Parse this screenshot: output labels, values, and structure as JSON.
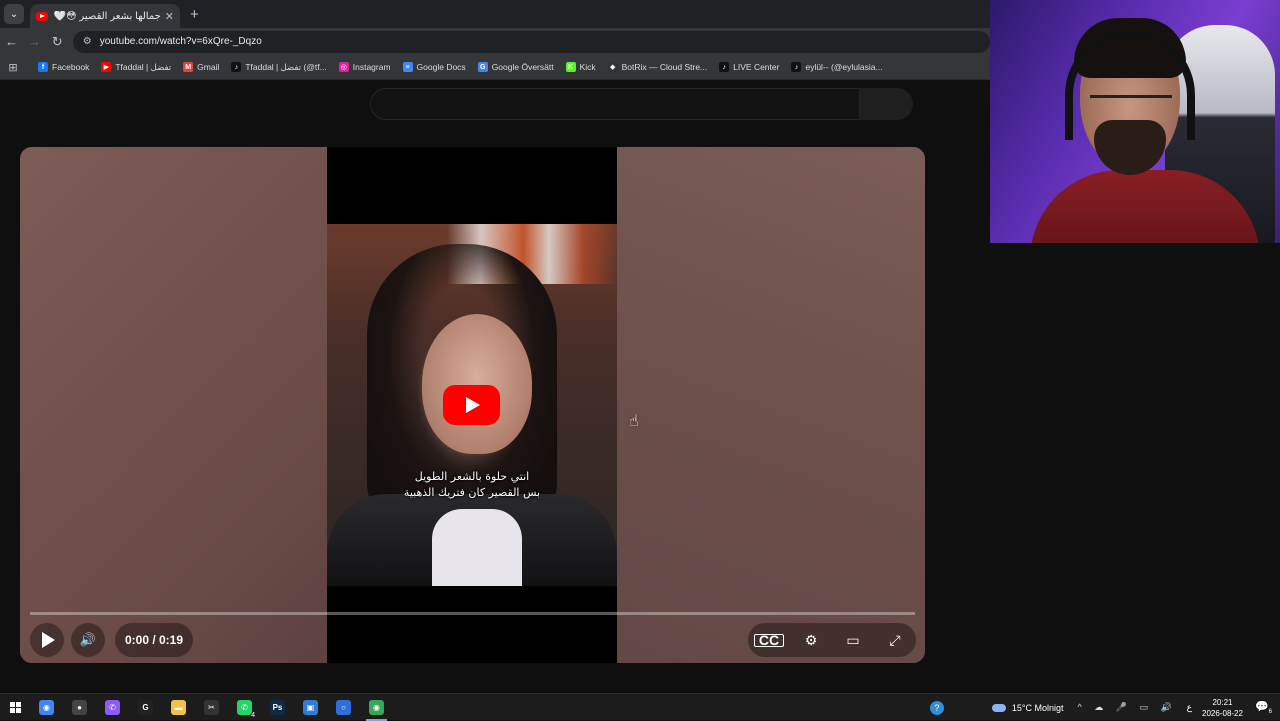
{
  "browser": {
    "tab_title": "جمالها بشعر القصير 😳🤍 #مسلسل",
    "tab_close": "✕",
    "new_tab": "+",
    "tab_dropdown": "⌄",
    "url": "youtube.com/watch?v=6xQre-_Dqzo",
    "nav": {
      "back": "←",
      "forward": "→",
      "reload": "↻",
      "site_info": "⚙"
    }
  },
  "bookmarks": [
    {
      "label": "Facebook",
      "icon": "facebook-icon",
      "color": "#1877f2",
      "glyph": "f"
    },
    {
      "label": "Tfaddal | تفضل",
      "icon": "youtube-icon",
      "color": "#ff0000",
      "glyph": "▶"
    },
    {
      "label": "Gmail",
      "icon": "gmail-icon",
      "color": "#ea4335",
      "glyph": "M"
    },
    {
      "label": "Tfaddal | تفضل (@tf...",
      "icon": "tiktok-icon",
      "color": "#111111",
      "glyph": "♪"
    },
    {
      "label": "Instagram",
      "icon": "instagram-icon",
      "color": "#d6249f",
      "glyph": "◎"
    },
    {
      "label": "Google Docs",
      "icon": "google-docs-icon",
      "color": "#4285f4",
      "glyph": "≡"
    },
    {
      "label": "Google Översätt",
      "icon": "google-translate-icon",
      "color": "#4285f4",
      "glyph": "G"
    },
    {
      "label": "Kick",
      "icon": "kick-icon",
      "color": "#53fc18",
      "glyph": "K"
    },
    {
      "label": "BotRix — Cloud Stre...",
      "icon": "botrix-icon",
      "color": "#333333",
      "glyph": "◆"
    },
    {
      "label": "LIVE Center",
      "icon": "tiktok-icon",
      "color": "#111111",
      "glyph": "♪"
    },
    {
      "label": "eylül-- (@eylulasia...",
      "icon": "tiktok-icon",
      "color": "#111111",
      "glyph": "♪"
    }
  ],
  "video": {
    "caption_line1": "انتي حلوة بالشعر الطويل",
    "caption_line2": "بس القصير كان فتريك الذهبية",
    "time": "0:00 / 0:19",
    "progress": 0.0
  },
  "controls": {
    "cc": "CC",
    "settings": "⚙",
    "theater": "▭",
    "fullscreen": "⤢",
    "volume": "🔊"
  },
  "taskbar": {
    "apps": [
      {
        "name": "chrome-icon",
        "color": "#4285f4",
        "glyph": "◉"
      },
      {
        "name": "obs-icon",
        "color": "#444444",
        "glyph": "●"
      },
      {
        "name": "messenger-icon",
        "color": "#8a5cf6",
        "glyph": "✆"
      },
      {
        "name": "g-hub-icon",
        "color": "#222222",
        "glyph": "G"
      },
      {
        "name": "file-explorer-icon",
        "color": "#f0c24b",
        "glyph": "▬"
      },
      {
        "name": "capcut-icon",
        "color": "#333333",
        "glyph": "✂"
      },
      {
        "name": "whatsapp-icon",
        "color": "#25d366",
        "glyph": "✆",
        "badge": "4"
      },
      {
        "name": "photoshop-icon",
        "color": "#0f2a44",
        "glyph": "Ps"
      },
      {
        "name": "desktop-icon",
        "color": "#2f7bd8",
        "glyph": "▣"
      },
      {
        "name": "app-ring-icon",
        "color": "#2e6fe0",
        "glyph": "○"
      },
      {
        "name": "chrome-active-icon",
        "color": "#34a853",
        "glyph": "◉"
      }
    ],
    "weather": "15°C  Molnigt",
    "lang": "ع",
    "time": "20:21",
    "date": "2026-08-22",
    "notif_count": "6",
    "help": "?"
  }
}
